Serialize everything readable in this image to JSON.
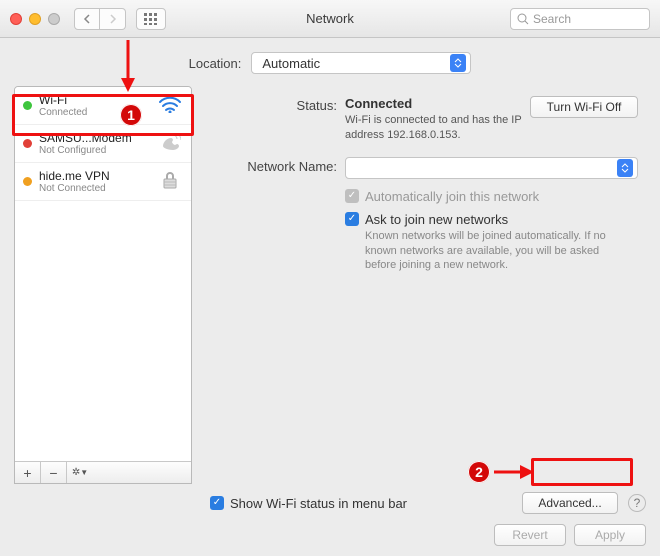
{
  "window": {
    "title": "Network",
    "search_placeholder": "Search"
  },
  "location": {
    "label": "Location:",
    "value": "Automatic"
  },
  "sidebar": {
    "items": [
      {
        "name": "Wi-Fi",
        "sub": "Connected",
        "status": "green",
        "icon": "wifi"
      },
      {
        "name": "SAMSU...Modem",
        "sub": "Not Configured",
        "status": "red",
        "icon": "phone"
      },
      {
        "name": "hide.me VPN",
        "sub": "Not Connected",
        "status": "amber",
        "icon": "lock"
      }
    ],
    "toolbar": {
      "plus": "+",
      "minus": "−",
      "gear": "✻▾"
    }
  },
  "detail": {
    "status_label": "Status:",
    "status_value": "Connected",
    "status_desc": "Wi-Fi is connected to            and has the IP address 192.168.0.153.",
    "turn_off": "Turn Wi-Fi Off",
    "network_name_label": "Network Name:",
    "network_name_value": " ",
    "auto_join": "Automatically join this network",
    "ask_join": "Ask to join new networks",
    "ask_join_desc": "Known networks will be joined automatically. If no known networks are available, you will be asked before joining a new network.",
    "show_status": "Show Wi-Fi status in menu bar",
    "advanced": "Advanced...",
    "revert": "Revert",
    "apply": "Apply"
  },
  "annotations": {
    "marker1": "1",
    "marker2": "2"
  }
}
